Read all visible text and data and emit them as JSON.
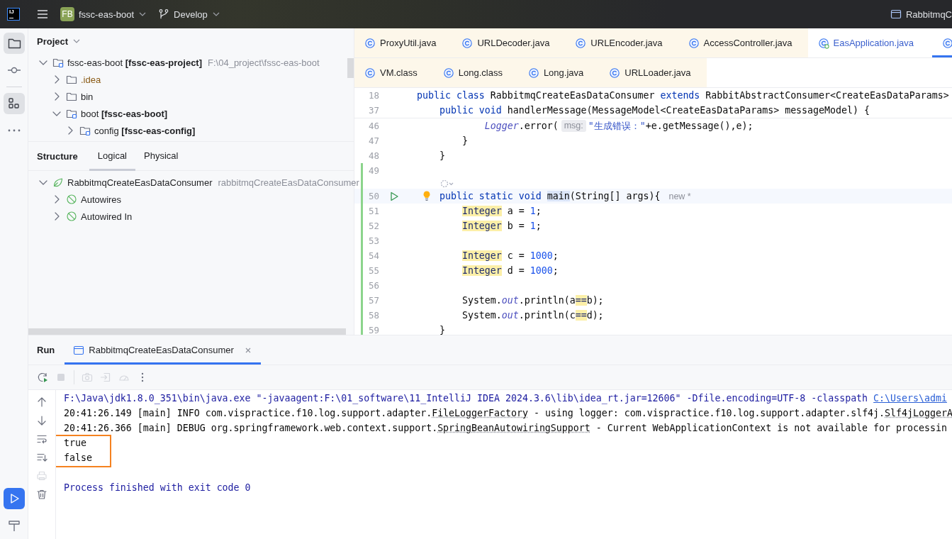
{
  "title_bar": {
    "logo_text": "IJ",
    "project_badge": "FB",
    "project_name": "fssc-eas-boot",
    "branch": "Develop",
    "run_config": "RabbitmqC"
  },
  "tool_strip": {
    "top": [
      {
        "kind": "folder",
        "selected": true
      },
      {
        "kind": "commit",
        "selected": false
      },
      {
        "kind": "separator"
      },
      {
        "kind": "structure",
        "selected": true
      },
      {
        "kind": "more",
        "selected": false
      }
    ],
    "bottom": [
      {
        "kind": "run",
        "selected": true
      },
      {
        "kind": "build",
        "selected": false
      }
    ]
  },
  "project_panel": {
    "title": "Project",
    "tree": [
      {
        "label": "fssc-eas-boot **[fssc-eas-project]**",
        "path": "F:\\04_project\\fssc-eas-boot",
        "kind": "module",
        "expanded": true,
        "ignored": false,
        "children": [
          {
            "label": ".idea",
            "kind": "folder",
            "expanded": false,
            "ignored": true
          },
          {
            "label": "bin",
            "kind": "folder",
            "expanded": false,
            "ignored": false
          },
          {
            "label": "boot **[fssc-eas-boot]**",
            "kind": "module",
            "expanded": true,
            "ignored": false,
            "children": [
              {
                "label": "config **[fssc-eas-config]**",
                "kind": "module",
                "expanded": false,
                "ignored": false
              }
            ]
          }
        ]
      }
    ]
  },
  "structure_panel": {
    "title": "Structure",
    "tabs": [
      {
        "label": "Logical",
        "selected": true
      },
      {
        "label": "Physical",
        "selected": false
      }
    ],
    "tree": [
      {
        "label": "RabbitmqCreateEasDataConsumer",
        "detail": "rabbitmqCreateEasDataConsumer",
        "kind": "bean",
        "expanded": true,
        "children": [
          {
            "label": "Autowires",
            "kind": "autowire",
            "expanded": false
          },
          {
            "label": "Autowired In",
            "kind": "autowire",
            "expanded": false
          }
        ]
      }
    ]
  },
  "editor": {
    "tab_rows": [
      [
        {
          "label": "ProxyUtil.java",
          "library": true,
          "modified": false,
          "selected": false
        },
        {
          "label": "URLDecoder.java",
          "library": true,
          "modified": false,
          "selected": false
        },
        {
          "label": "URLEncoder.java",
          "library": true,
          "modified": false,
          "selected": false
        },
        {
          "label": "AccessController.java",
          "library": true,
          "modified": false,
          "selected": false
        },
        {
          "label": "EasApplication.java",
          "library": false,
          "modified": true,
          "selected": false
        },
        {
          "library": false,
          "modified": false,
          "selected": true
        }
      ],
      [
        {
          "label": "VM.class",
          "library": true,
          "modified": false,
          "selected": false
        },
        {
          "label": "Long.class",
          "library": true,
          "modified": false,
          "selected": false
        },
        {
          "label": "Long.java",
          "library": true,
          "modified": false,
          "selected": false
        },
        {
          "label": "URLLoader.java",
          "library": true,
          "modified": false,
          "selected": false
        }
      ]
    ],
    "sticky_lines": [
      {
        "number": "18",
        "tokens": [
          {
            "kind": "kw",
            "text": "public class "
          },
          {
            "kind": "pl",
            "text": "RabbitmqCreateEasDataConsumer "
          },
          {
            "kind": "kw",
            "text": "extends "
          },
          {
            "kind": "pl",
            "text": "RabbitAbstractConsumer<CreateEasDataParams>"
          }
        ]
      },
      {
        "number": "37",
        "tokens": [
          {
            "kind": "kw",
            "text": "    public void "
          },
          {
            "kind": "pl",
            "text": "handlerMessage(MessageModel<CreateEasDataParams> messageModel) {"
          }
        ]
      }
    ],
    "lines": [
      {
        "kind": "code",
        "number": "46",
        "current": false,
        "changed": false,
        "tokens": [
          {
            "kind": "fld",
            "text": "            Logger"
          },
          {
            "kind": "pl",
            "text": ".error("
          },
          {
            "kind": "hint",
            "text": "msg:"
          },
          {
            "kind": "str",
            "text": "\"生成错误：\""
          },
          {
            "kind": "pl",
            "text": "+e.getMessage(),e);"
          }
        ]
      },
      {
        "kind": "code",
        "number": "47",
        "current": false,
        "changed": false,
        "tokens": [
          {
            "kind": "pl",
            "text": "        }"
          }
        ]
      },
      {
        "kind": "code",
        "number": "48",
        "current": false,
        "changed": false,
        "tokens": [
          {
            "kind": "pl",
            "text": "    }"
          }
        ]
      },
      {
        "kind": "code",
        "number": "49",
        "current": false,
        "changed": true
      },
      {
        "kind": "vision",
        "current": false,
        "changed": true
      },
      {
        "kind": "code",
        "number": "50",
        "current": true,
        "changed": true,
        "gutter": [
          {
            "kind": "run"
          },
          {
            "kind": "bulb"
          }
        ],
        "tokens": [
          {
            "kind": "kw",
            "text": "    public static void "
          },
          {
            "kind": "sel",
            "text": "main"
          },
          {
            "kind": "pl",
            "text": "(String[] args){"
          },
          {
            "kind": "vision",
            "text": "new *"
          }
        ]
      },
      {
        "kind": "code",
        "number": "51",
        "current": false,
        "changed": true,
        "tokens": [
          {
            "kind": "hl",
            "text": "        Integer"
          },
          {
            "kind": "pl",
            "text": " a = "
          },
          {
            "kind": "num",
            "text": "1"
          },
          {
            "kind": "pl",
            "text": ";"
          }
        ]
      },
      {
        "kind": "code",
        "number": "52",
        "current": false,
        "changed": true,
        "tokens": [
          {
            "kind": "hl",
            "text": "        Integer"
          },
          {
            "kind": "pl",
            "text": " b = "
          },
          {
            "kind": "num",
            "text": "1"
          },
          {
            "kind": "pl",
            "text": ";"
          }
        ]
      },
      {
        "kind": "code",
        "number": "53",
        "current": false,
        "changed": true
      },
      {
        "kind": "code",
        "number": "54",
        "current": false,
        "changed": true,
        "tokens": [
          {
            "kind": "hl",
            "text": "        Integer"
          },
          {
            "kind": "pl",
            "text": " c = "
          },
          {
            "kind": "num",
            "text": "1000"
          },
          {
            "kind": "pl",
            "text": ";"
          }
        ]
      },
      {
        "kind": "code",
        "number": "55",
        "current": false,
        "changed": true,
        "tokens": [
          {
            "kind": "hl",
            "text": "        Integer"
          },
          {
            "kind": "pl",
            "text": " d = "
          },
          {
            "kind": "num",
            "text": "1000"
          },
          {
            "kind": "pl",
            "text": ";"
          }
        ]
      },
      {
        "kind": "code",
        "number": "56",
        "current": false,
        "changed": true
      },
      {
        "kind": "code",
        "number": "57",
        "current": false,
        "changed": true,
        "tokens": [
          {
            "kind": "pl",
            "text": "        System."
          },
          {
            "kind": "fld",
            "text": "out"
          },
          {
            "kind": "pl",
            "text": ".println(a"
          },
          {
            "kind": "hl",
            "text": "=="
          },
          {
            "kind": "pl",
            "text": "b);"
          }
        ]
      },
      {
        "kind": "code",
        "number": "58",
        "current": false,
        "changed": true,
        "tokens": [
          {
            "kind": "pl",
            "text": "        System."
          },
          {
            "kind": "fld",
            "text": "out"
          },
          {
            "kind": "pl",
            "text": ".println(c"
          },
          {
            "kind": "hl",
            "text": "=="
          },
          {
            "kind": "pl",
            "text": "d);"
          }
        ]
      },
      {
        "kind": "code",
        "number": "59",
        "current": false,
        "changed": true,
        "tokens": [
          {
            "kind": "pl",
            "text": "    }"
          }
        ]
      }
    ]
  },
  "run_panel": {
    "title": "Run",
    "tabs": [
      {
        "label": "RabbitmqCreateEasDataConsumer",
        "selected": true
      }
    ],
    "toolbar": [
      {
        "kind": "rerun",
        "disabled": false
      },
      {
        "kind": "stop",
        "disabled": true
      },
      {
        "kind": "separator"
      },
      {
        "kind": "camera",
        "disabled": true
      },
      {
        "kind": "import",
        "disabled": true
      },
      {
        "kind": "gauge",
        "disabled": true
      },
      {
        "kind": "more",
        "disabled": false
      }
    ],
    "side_actions": [
      {
        "kind": "up",
        "disabled": false
      },
      {
        "kind": "down",
        "disabled": false
      },
      {
        "kind": "wrap",
        "disabled": false
      },
      {
        "kind": "scroll-end",
        "disabled": false
      },
      {
        "kind": "print",
        "disabled": true
      },
      {
        "kind": "trash",
        "disabled": false
      }
    ],
    "console": [
      {
        "kind": "command",
        "boxed": false,
        "segments": [
          {
            "kind": "text",
            "text": "F:\\Java\\jdk1.8.0_351\\bin\\java.exe \"-javaagent:F:\\01_software\\11_IntelliJ IDEA 2024.3.6\\lib\\idea_rt.jar=12606\" -Dfile.encoding=UTF-8 -classpath "
          },
          {
            "kind": "link",
            "text": "C:\\Users\\admi"
          }
        ]
      },
      {
        "kind": "log",
        "boxed": false,
        "segments": [
          {
            "kind": "text",
            "text": "20:41:26.149 [main] INFO com.vispractice.f10.log.support.adapter."
          },
          {
            "kind": "class",
            "text": "FileLoggerFactory"
          },
          {
            "kind": "text",
            "text": " - using logger: com.vispractice.f10.log.support.adapter.slf4j."
          },
          {
            "kind": "class",
            "text": "Slf4jLoggerA"
          }
        ]
      },
      {
        "kind": "log",
        "boxed": false,
        "segments": [
          {
            "kind": "text",
            "text": "20:41:26.366 [main] DEBUG org.springframework.web.context.support."
          },
          {
            "kind": "class",
            "text": "SpringBeanAutowiringSupport"
          },
          {
            "kind": "text",
            "text": " - Current WebApplicationContext is not available for processin"
          }
        ]
      },
      {
        "kind": "log",
        "boxed": true,
        "segments": [
          {
            "kind": "text",
            "text": "true"
          }
        ]
      },
      {
        "kind": "log",
        "boxed": true,
        "segments": [
          {
            "kind": "text",
            "text": "false"
          }
        ]
      },
      {
        "kind": "exit",
        "boxed": false,
        "segments": [
          {
            "kind": "text",
            "text": "Process finished with exit code 0"
          }
        ]
      }
    ]
  }
}
